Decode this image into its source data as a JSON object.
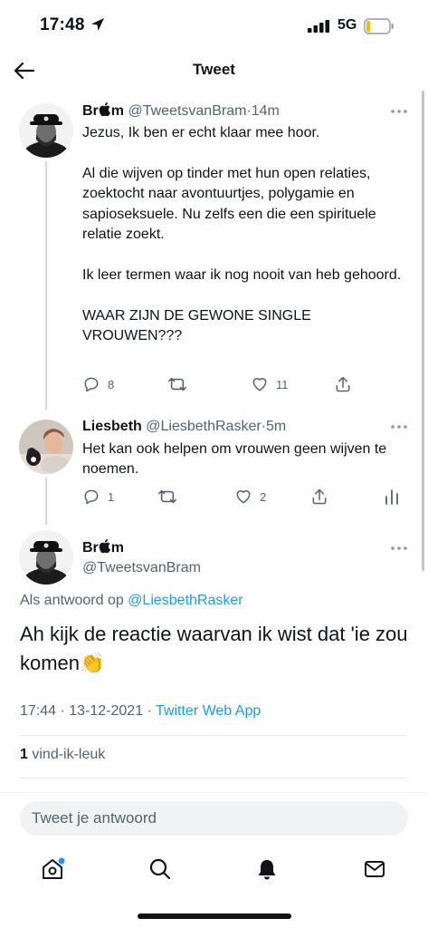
{
  "status_bar": {
    "time": "17:48",
    "network": "5G"
  },
  "header": {
    "title": "Tweet",
    "back_icon": "arrow-left-icon"
  },
  "tweets": [
    {
      "name": "Br",
      "handle": "@TweetsvanBram",
      "time": "14m",
      "text": "Jezus, Ik ben er echt klaar mee hoor.\n\nAl die wijven op tinder met hun open relaties, zoektocht naar avontuurtjes, polygamie en sapioseksuele. Nu zelfs een die een spirituele relatie zoekt.\n\nIk leer termen waar ik nog nooit van heb gehoord.\n\nWAAR ZIJN DE GEWONE SINGLE VROUWEN???",
      "replies": "8",
      "likes": "11"
    },
    {
      "name": "Liesbeth",
      "handle": "@LiesbethRasker",
      "time": "5m",
      "text": "Het kan ook helpen om vrouwen geen wijven te noemen.",
      "replies": "1",
      "likes": "2"
    }
  ],
  "main_tweet": {
    "name": "Br",
    "handle": "@TweetsvanBram",
    "reply_prefix": "Als antwoord op",
    "reply_to": "@LiesbethRasker",
    "text": "Ah kijk de reactie waarvan ik wist dat 'ie zou komen",
    "emoji": "👏",
    "timestamp": "17:44 · 13-12-2021 ·",
    "source": "Twitter Web App",
    "like_count": "1",
    "like_label": "vind-ik-leuk"
  },
  "composer": {
    "placeholder": "Tweet je antwoord"
  },
  "tabbar": {
    "items": [
      "home-icon",
      "search-icon",
      "bell-icon",
      "mail-icon"
    ]
  },
  "colors": {
    "accent": "#1d9bf0",
    "secondary_text": "#536471",
    "primary_text": "#0f1419"
  }
}
